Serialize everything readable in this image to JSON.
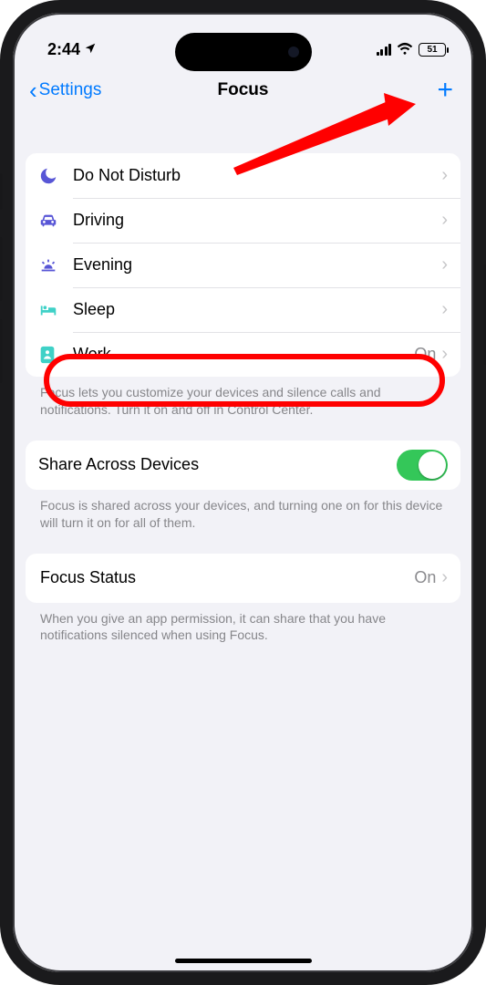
{
  "status": {
    "time": "2:44",
    "battery_pct": "51"
  },
  "nav": {
    "back_label": "Settings",
    "title": "Focus",
    "add_symbol": "+"
  },
  "focus_modes": [
    {
      "id": "dnd",
      "label": "Do Not Disturb",
      "icon": "moon",
      "value": ""
    },
    {
      "id": "driving",
      "label": "Driving",
      "icon": "car",
      "value": ""
    },
    {
      "id": "evening",
      "label": "Evening",
      "icon": "sunset",
      "value": ""
    },
    {
      "id": "sleep",
      "label": "Sleep",
      "icon": "bed",
      "value": ""
    },
    {
      "id": "work",
      "label": "Work",
      "icon": "badge",
      "value": "On"
    }
  ],
  "focus_footer": "Focus lets you customize your devices and silence calls and notifications. Turn it on and off in Control Center.",
  "share": {
    "label": "Share Across Devices",
    "enabled": true,
    "footer": "Focus is shared across your devices, and turning one on for this device will turn it on for all of them."
  },
  "focus_status": {
    "label": "Focus Status",
    "value": "On",
    "footer": "When you give an app permission, it can share that you have notifications silenced when using Focus."
  },
  "annotations": {
    "highlighted_row": "work",
    "arrow_points_to": "add-focus-button"
  }
}
